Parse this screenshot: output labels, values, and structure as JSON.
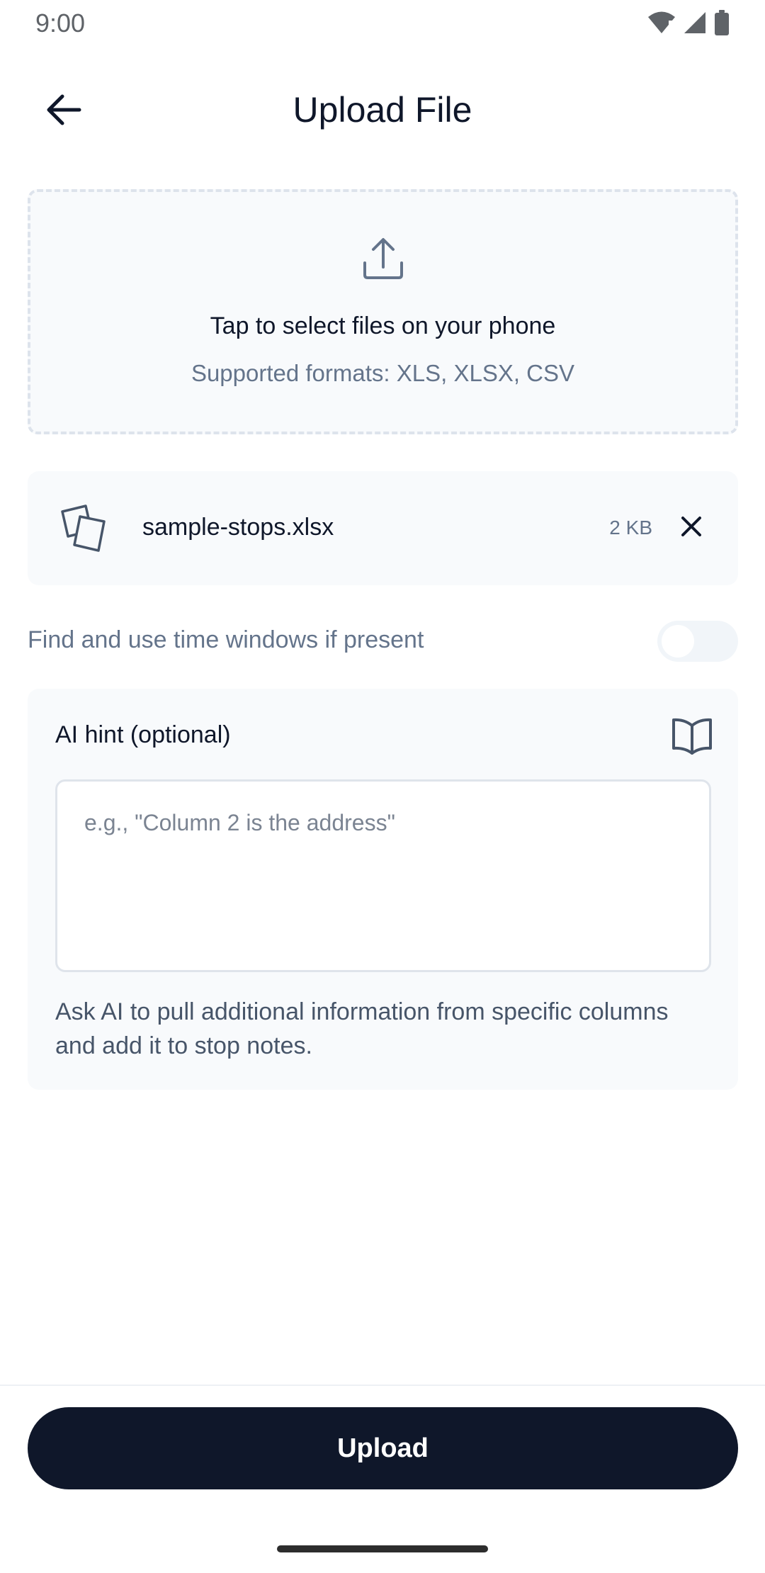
{
  "status_bar": {
    "time": "9:00"
  },
  "header": {
    "title": "Upload File"
  },
  "drop_zone": {
    "title": "Tap to select files on your phone",
    "subtitle": "Supported formats: XLS, XLSX, CSV"
  },
  "file": {
    "name": "sample-stops.xlsx",
    "size": "2 KB"
  },
  "time_windows": {
    "label": "Find and use time windows if present",
    "enabled": false
  },
  "ai_hint": {
    "title": "AI hint (optional)",
    "placeholder": "e.g., \"Column 2 is the address\"",
    "value": "",
    "help": "Ask AI to pull additional information from specific columns and add it to stop notes."
  },
  "actions": {
    "upload_label": "Upload"
  },
  "colors": {
    "primary": "#0f172a",
    "muted": "#64748b",
    "card_bg": "#f8fafc"
  }
}
